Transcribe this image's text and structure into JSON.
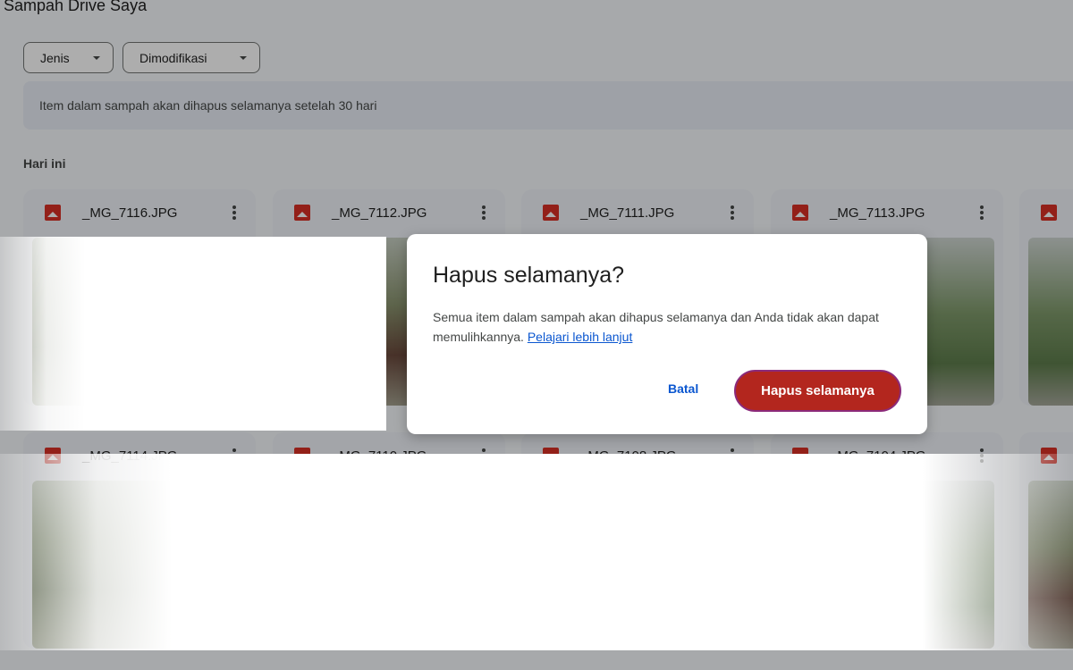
{
  "page": {
    "title": "Sampah Drive Saya"
  },
  "filters": [
    {
      "label": "Jenis"
    },
    {
      "label": "Dimodifikasi"
    }
  ],
  "notice": {
    "text": "Item dalam sampah akan dihapus selamanya setelah 30 hari"
  },
  "section": {
    "label": "Hari ini"
  },
  "files": [
    {
      "name": "_MG_7116.JPG"
    },
    {
      "name": "_MG_7112.JPG"
    },
    {
      "name": "_MG_7111.JPG"
    },
    {
      "name": "_MG_7113.JPG"
    },
    {
      "name": ""
    },
    {
      "name": "_MG_7114.JPG"
    },
    {
      "name": "_MG_7110.JPG"
    },
    {
      "name": "_MG_7108.JPG"
    },
    {
      "name": "_MG_7104.JPG"
    },
    {
      "name": ""
    }
  ],
  "dialog": {
    "title": "Hapus selamanya?",
    "body": "Semua item dalam sampah akan dihapus selamanya dan Anda tidak akan dapat memulihkannya.",
    "link": "Pelajari lebih lanjut",
    "cancel_label": "Batal",
    "confirm_label": "Hapus selamanya"
  },
  "colors": {
    "confirm_button": "#b3261e",
    "link": "#0b57d0",
    "file_icon": "#d93025"
  },
  "icons": {
    "file": "image-file-icon",
    "more": "more-vert-icon",
    "dropdown": "dropdown-caret-icon"
  }
}
